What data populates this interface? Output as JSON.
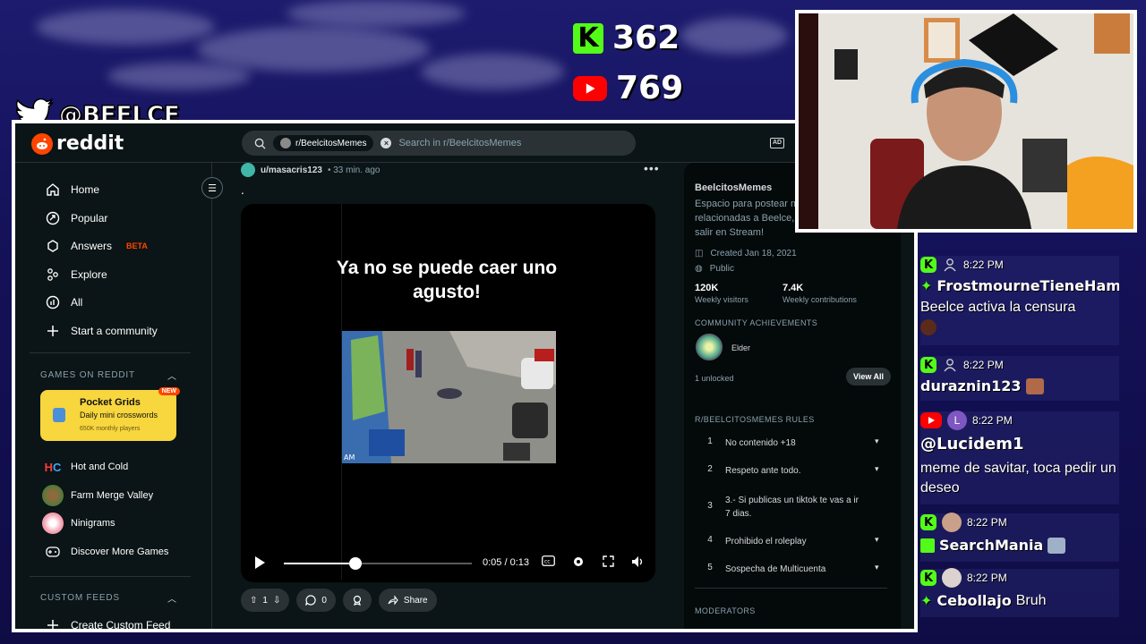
{
  "overlay": {
    "twitter_handle": "@BEELCE_",
    "kick_viewers": "362",
    "youtube_viewers": "769"
  },
  "topbar": {
    "logo_text": "reddit",
    "search_chip": "r/BeelcitosMemes",
    "search_placeholder": "Search in r/BeelcitosMemes"
  },
  "sidebar": {
    "nav": [
      {
        "label": "Home",
        "icon": "home-icon"
      },
      {
        "label": "Popular",
        "icon": "popular-icon"
      },
      {
        "label": "Answers",
        "icon": "answers-icon",
        "badge": "BETA"
      },
      {
        "label": "Explore",
        "icon": "explore-icon"
      },
      {
        "label": "All",
        "icon": "all-icon"
      },
      {
        "label": "Start a community",
        "icon": "plus-icon"
      }
    ],
    "games_title": "GAMES ON REDDIT",
    "featured_game": {
      "title": "Pocket Grids",
      "subtitle": "Daily mini crosswords",
      "players": "650K monthly players",
      "badge": "NEW"
    },
    "games": [
      "Hot and Cold",
      "Farm Merge Valley",
      "Ninigrams",
      "Discover More Games"
    ],
    "custom_feeds_title": "CUSTOM FEEDS",
    "create_feed": "Create Custom Feed"
  },
  "post": {
    "user": "u/masacris123",
    "time": "• 33 min. ago",
    "body": ".",
    "video_caption": "Ya no se puede caer uno agusto!",
    "clip_label": "AM",
    "current_time": "0:05 / 0:13",
    "progress": 0.38,
    "votes": "1",
    "comments": "0",
    "share": "Share"
  },
  "community": {
    "name": "BeelcitosMemes",
    "description": "Espacio para postear me\nrelacionadas a Beelce, lo\nsalir en Stream!",
    "created": "Created Jan 18, 2021",
    "visibility": "Public",
    "stats": [
      {
        "value": "120K",
        "label": "Weekly visitors"
      },
      {
        "value": "7.4K",
        "label": "Weekly contributions"
      }
    ],
    "achievements_title": "COMMUNITY ACHIEVEMENTS",
    "achievement": "Elder",
    "unlocked": "1 unlocked",
    "view_all": "View All",
    "rules_title": "R/BEELCITOSMEMES RULES",
    "rules": [
      {
        "n": "1",
        "text": "No contenido +18"
      },
      {
        "n": "2",
        "text": "Respeto ante todo."
      },
      {
        "n": "3",
        "text": "3.- Si publicas un tiktok te vas a ir 7 dias."
      },
      {
        "n": "4",
        "text": "Prohibido el roleplay"
      },
      {
        "n": "5",
        "text": "Sospecha de Multicuenta"
      }
    ],
    "moderators_title": "MODERATORS"
  },
  "chat": [
    {
      "platform": "kick",
      "time": "8:22 PM",
      "user": "FrostmourneTieneHamb",
      "message": "Beelce activa la censura"
    },
    {
      "platform": "kick",
      "time": "8:22 PM",
      "user": "duraznin123",
      "message": ""
    },
    {
      "platform": "youtube",
      "time": "8:22 PM",
      "avatar_letter": "L",
      "user": "@Lucidem1",
      "message": "meme de savitar, toca pedir un deseo"
    },
    {
      "platform": "kick",
      "time": "8:22 PM",
      "user": "SearchMania",
      "message": ""
    },
    {
      "platform": "kick",
      "time": "8:22 PM",
      "user": "Cebollajo",
      "message": "Bruh"
    }
  ],
  "colors": {
    "kick": "#53fc18",
    "youtube": "#ff0000",
    "reddit_orange": "#ff4500",
    "reddit_bg": "#0b1416"
  }
}
